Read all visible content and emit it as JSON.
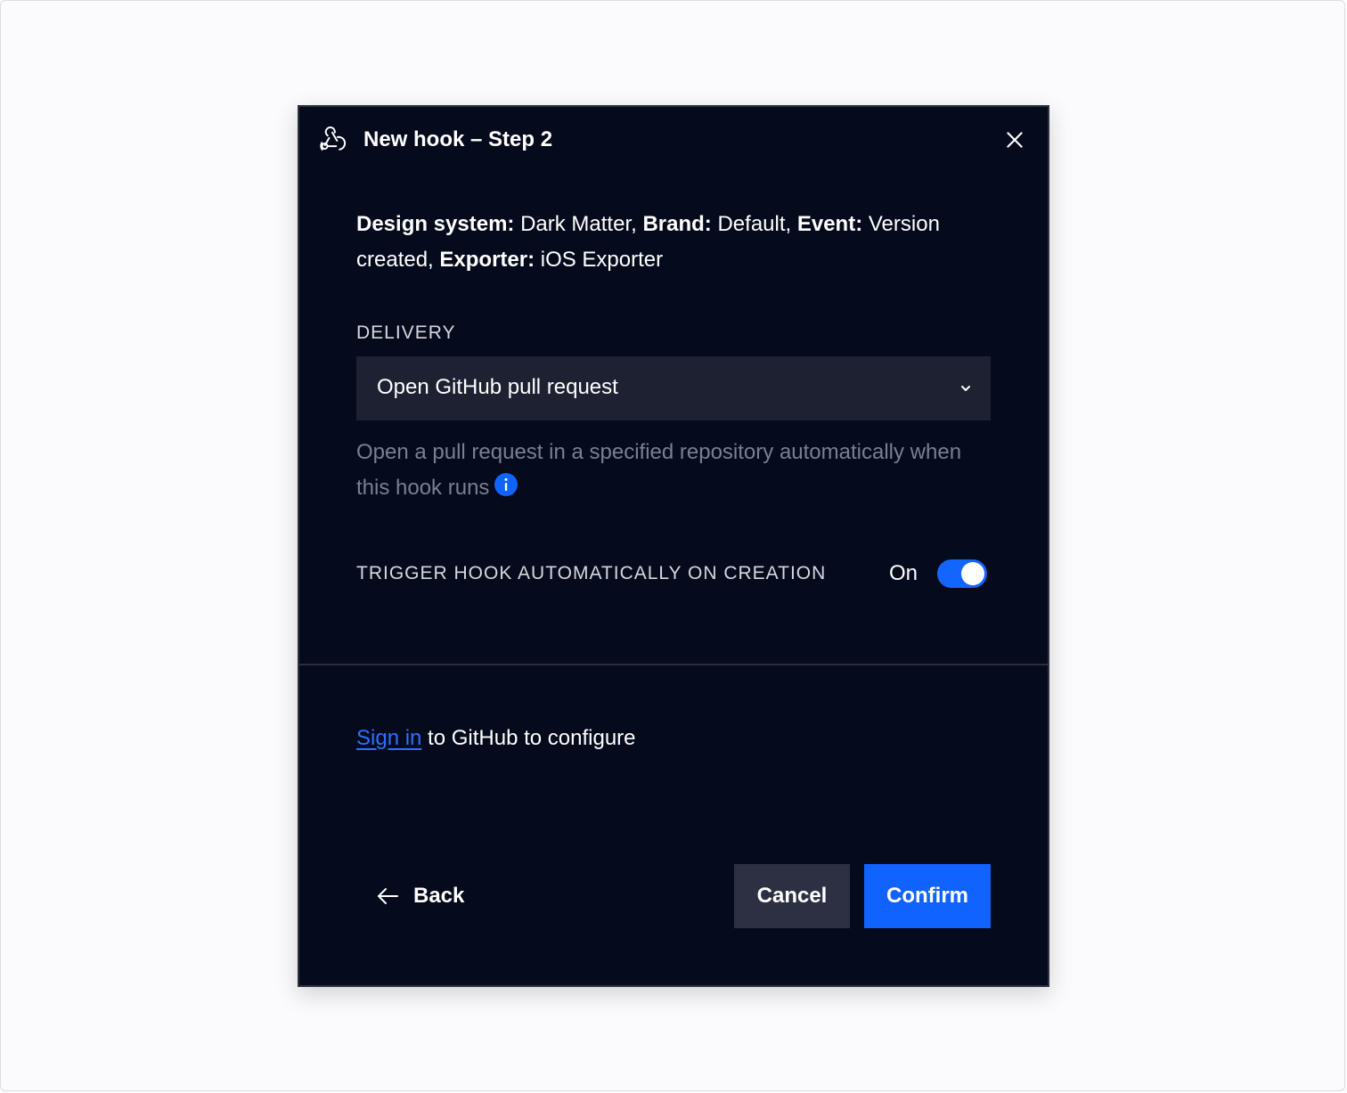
{
  "dialog": {
    "title": "New hook – Step 2",
    "icon": "webhook-icon",
    "close_icon": "close-icon"
  },
  "summary": {
    "design_system_label": "Design system:",
    "design_system_value": " Dark Matter, ",
    "brand_label": "Brand:",
    "brand_value": " Default, ",
    "event_label": "Event:",
    "event_value": " Version created, ",
    "exporter_label": "Exporter:",
    "exporter_value": " iOS Exporter"
  },
  "delivery": {
    "label": "DELIVERY",
    "selected": "Open GitHub pull request",
    "helper_text": "Open a pull request in a specified repository automatically when this hook runs"
  },
  "trigger": {
    "label": "TRIGGER HOOK AUTOMATICALLY ON CREATION",
    "state_text": "On",
    "enabled": true
  },
  "signin": {
    "link_text": "Sign in",
    "rest_text": " to GitHub to configure"
  },
  "footer": {
    "back_label": "Back",
    "cancel_label": "Cancel",
    "confirm_label": "Confirm"
  },
  "colors": {
    "dialog_bg": "#050a1c",
    "accent": "#1063ff",
    "select_bg": "#1d2132",
    "cancel_bg": "#2c3042",
    "helper_text": "#7a7f95",
    "link": "#2f6fff"
  }
}
